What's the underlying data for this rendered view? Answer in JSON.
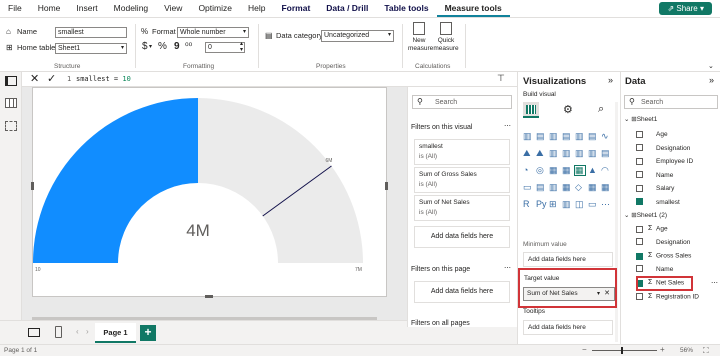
{
  "menu": [
    "File",
    "Home",
    "Insert",
    "Modeling",
    "View",
    "Optimize",
    "Help",
    "Format",
    "Data / Drill",
    "Table tools",
    "Measure tools"
  ],
  "share_label": "Share",
  "ribbon": {
    "name_label": "Name",
    "name_value": "smallest",
    "home_table_label": "Home table",
    "home_table_value": "Sheet1",
    "structure_label": "Structure",
    "format_label": "Format",
    "format_value": "Whole number",
    "currency": "$",
    "percent": "%",
    "comma": "9",
    "decimal": "⁰⁰",
    "decimal_value": "0",
    "formatting_label": "Formatting",
    "data_category_label": "Data category",
    "data_category_value": "Uncategorized",
    "properties_label": "Properties",
    "new_measure_label": "New measure",
    "quick_measure_label": "Quick measure",
    "calculations_label": "Calculations"
  },
  "formula": {
    "line": "1",
    "text": "smallest = ",
    "value": "10"
  },
  "gauge": {
    "value_label": "4M",
    "target_label": "6M",
    "min_label": "10",
    "max_label": "7M",
    "fill_fraction": 0.5,
    "target_fraction": 0.8,
    "fill_color": "#118dff",
    "track_color": "#ebebeb"
  },
  "filters": {
    "search_placeholder": "Search",
    "on_visual": "Filters on this visual",
    "cards": [
      {
        "title": "smallest",
        "sub": "is (All)"
      },
      {
        "title": "Sum of Gross Sales",
        "sub": "is (All)"
      },
      {
        "title": "Sum of Net Sales",
        "sub": "is (All)"
      }
    ],
    "add_fields": "Add data fields here",
    "on_page": "Filters on this page",
    "add_fields_page": "Add data fields here",
    "on_all_pages": "Filters on all pages"
  },
  "viz": {
    "title": "Visualizations",
    "build_visual": "Build visual",
    "minimum_value": "Minimum value",
    "add_fields_min": "Add data fields here",
    "target_value_label": "Target value",
    "target_value_field": "Sum of Net Sales",
    "tooltips": "Tooltips",
    "add_fields_tooltips": "Add data fields here"
  },
  "data": {
    "title": "Data",
    "search_placeholder": "Search",
    "table1": "Sheet1",
    "table1_fields": [
      {
        "name": "Age",
        "checked": false,
        "sigma": false
      },
      {
        "name": "Designation",
        "checked": false,
        "sigma": false
      },
      {
        "name": "Employee ID",
        "checked": false,
        "sigma": false
      },
      {
        "name": "Name",
        "checked": false,
        "sigma": false
      },
      {
        "name": "Salary",
        "checked": false,
        "sigma": false
      },
      {
        "name": "smallest",
        "checked": true,
        "sigma": false
      }
    ],
    "table2": "Sheet1 (2)",
    "table2_fields": [
      {
        "name": "Age",
        "checked": false,
        "sigma": true
      },
      {
        "name": "Designation",
        "checked": false,
        "sigma": false
      },
      {
        "name": "Gross Sales",
        "checked": true,
        "sigma": true
      },
      {
        "name": "Name",
        "checked": false,
        "sigma": false
      },
      {
        "name": "Net Sales",
        "checked": true,
        "sigma": true
      },
      {
        "name": "Registration ID",
        "checked": false,
        "sigma": true
      }
    ]
  },
  "page_tab": "Page 1",
  "add_page": "+",
  "status": {
    "page": "Page 1 of 1",
    "zoom": "56%"
  }
}
